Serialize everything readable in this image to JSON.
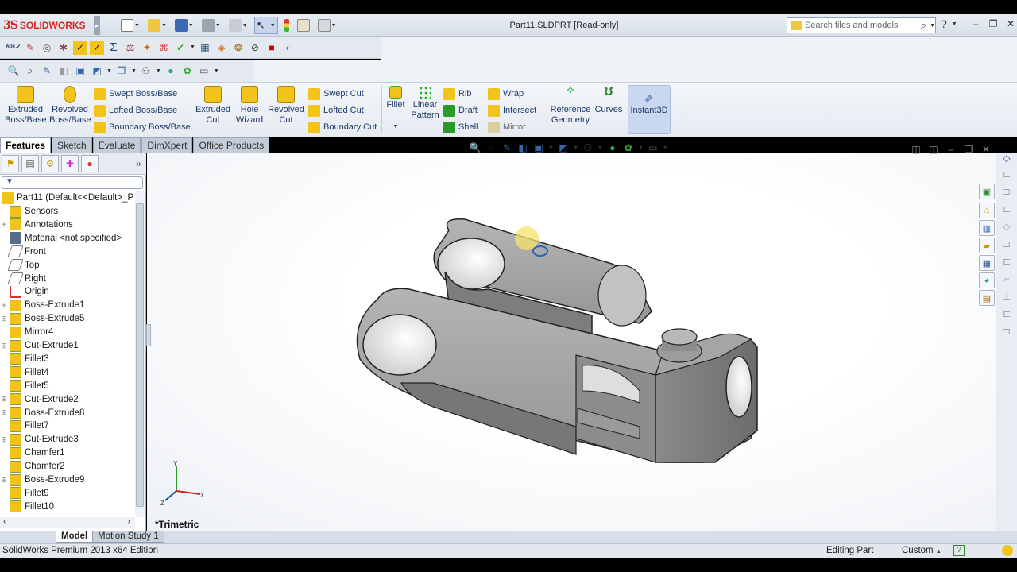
{
  "app": {
    "logo_ds": "3S",
    "logo_text": "SOLIDWORKS",
    "document_title": "Part11.SLDPRT [Read-only]"
  },
  "search": {
    "placeholder": "Search files and models"
  },
  "help": {
    "help_label": "?"
  },
  "command_manager": {
    "big_buttons": [
      {
        "label": "Extruded\nBoss/Base",
        "icon": "extruded-boss-icon"
      },
      {
        "label": "Revolved\nBoss/Base",
        "icon": "revolved-boss-icon"
      },
      {
        "label": "Extruded\nCut",
        "icon": "extruded-cut-icon"
      },
      {
        "label": "Hole\nWizard",
        "icon": "hole-wizard-icon"
      },
      {
        "label": "Revolved\nCut",
        "icon": "revolved-cut-icon"
      },
      {
        "label": "Fillet",
        "icon": "fillet-icon"
      },
      {
        "label": "Linear\nPattern",
        "icon": "linear-pattern-icon"
      },
      {
        "label": "Reference\nGeometry",
        "icon": "reference-geometry-icon"
      },
      {
        "label": "Curves",
        "icon": "curves-icon"
      },
      {
        "label": "Instant3D",
        "icon": "instant3d-icon"
      }
    ],
    "small_buttons": [
      {
        "label": "Swept Boss/Base",
        "icon": "swept-boss-icon"
      },
      {
        "label": "Lofted Boss/Base",
        "icon": "lofted-boss-icon"
      },
      {
        "label": "Boundary Boss/Base",
        "icon": "boundary-boss-icon"
      },
      {
        "label": "Swept Cut",
        "icon": "swept-cut-icon"
      },
      {
        "label": "Lofted Cut",
        "icon": "lofted-cut-icon"
      },
      {
        "label": "Boundary Cut",
        "icon": "boundary-cut-icon"
      },
      {
        "label": "Rib",
        "icon": "rib-icon"
      },
      {
        "label": "Draft",
        "icon": "draft-icon"
      },
      {
        "label": "Shell",
        "icon": "shell-icon"
      },
      {
        "label": "Wrap",
        "icon": "wrap-icon"
      },
      {
        "label": "Intersect",
        "icon": "intersect-icon"
      },
      {
        "label": "Mirror",
        "icon": "mirror-icon"
      }
    ]
  },
  "tabs": [
    "Features",
    "Sketch",
    "Evaluate",
    "DimXpert",
    "Office Products"
  ],
  "tree": {
    "root": "Part11  (Default<<Default>_P",
    "items": [
      {
        "label": "Sensors",
        "icon": "sensors-icon",
        "expandable": false
      },
      {
        "label": "Annotations",
        "icon": "annotations-icon",
        "expandable": true
      },
      {
        "label": "Material <not specified>",
        "icon": "material-icon",
        "expandable": false
      },
      {
        "label": "Front",
        "icon": "plane-icon",
        "expandable": false
      },
      {
        "label": "Top",
        "icon": "plane-icon",
        "expandable": false
      },
      {
        "label": "Right",
        "icon": "plane-icon",
        "expandable": false
      },
      {
        "label": "Origin",
        "icon": "origin-icon",
        "expandable": false
      },
      {
        "label": "Boss-Extrude1",
        "icon": "boss-extrude-icon",
        "expandable": true
      },
      {
        "label": "Boss-Extrude5",
        "icon": "boss-extrude-icon",
        "expandable": true
      },
      {
        "label": "Mirror4",
        "icon": "mirror-feature-icon",
        "expandable": false
      },
      {
        "label": "Cut-Extrude1",
        "icon": "cut-extrude-icon",
        "expandable": true
      },
      {
        "label": "Fillet3",
        "icon": "fillet-feature-icon",
        "expandable": false
      },
      {
        "label": "Fillet4",
        "icon": "fillet-feature-icon",
        "expandable": false
      },
      {
        "label": "Fillet5",
        "icon": "fillet-feature-icon",
        "expandable": false
      },
      {
        "label": "Cut-Extrude2",
        "icon": "cut-extrude-icon",
        "expandable": true
      },
      {
        "label": "Boss-Extrude8",
        "icon": "boss-extrude-icon",
        "expandable": true
      },
      {
        "label": "Fillet7",
        "icon": "fillet-feature-icon",
        "expandable": false
      },
      {
        "label": "Cut-Extrude3",
        "icon": "cut-extrude-icon",
        "expandable": true
      },
      {
        "label": "Chamfer1",
        "icon": "chamfer-icon",
        "expandable": false
      },
      {
        "label": "Chamfer2",
        "icon": "chamfer-icon",
        "expandable": false
      },
      {
        "label": "Boss-Extrude9",
        "icon": "boss-extrude-icon",
        "expandable": true
      },
      {
        "label": "Fillet9",
        "icon": "fillet-feature-icon",
        "expandable": false
      },
      {
        "label": "Fillet10",
        "icon": "fillet-feature-icon",
        "expandable": false
      }
    ]
  },
  "viewport": {
    "view_name": "*Trimetric"
  },
  "bottom_tabs": [
    "Model",
    "Motion Study 1"
  ],
  "status": {
    "edition": "SolidWorks Premium 2013 x64 Edition",
    "mode": "Editing Part",
    "units": "Custom"
  },
  "colors": {
    "accent": "#d8261f",
    "model_gray": "#9a9a9a",
    "feature_yellow": "#f2c318"
  }
}
